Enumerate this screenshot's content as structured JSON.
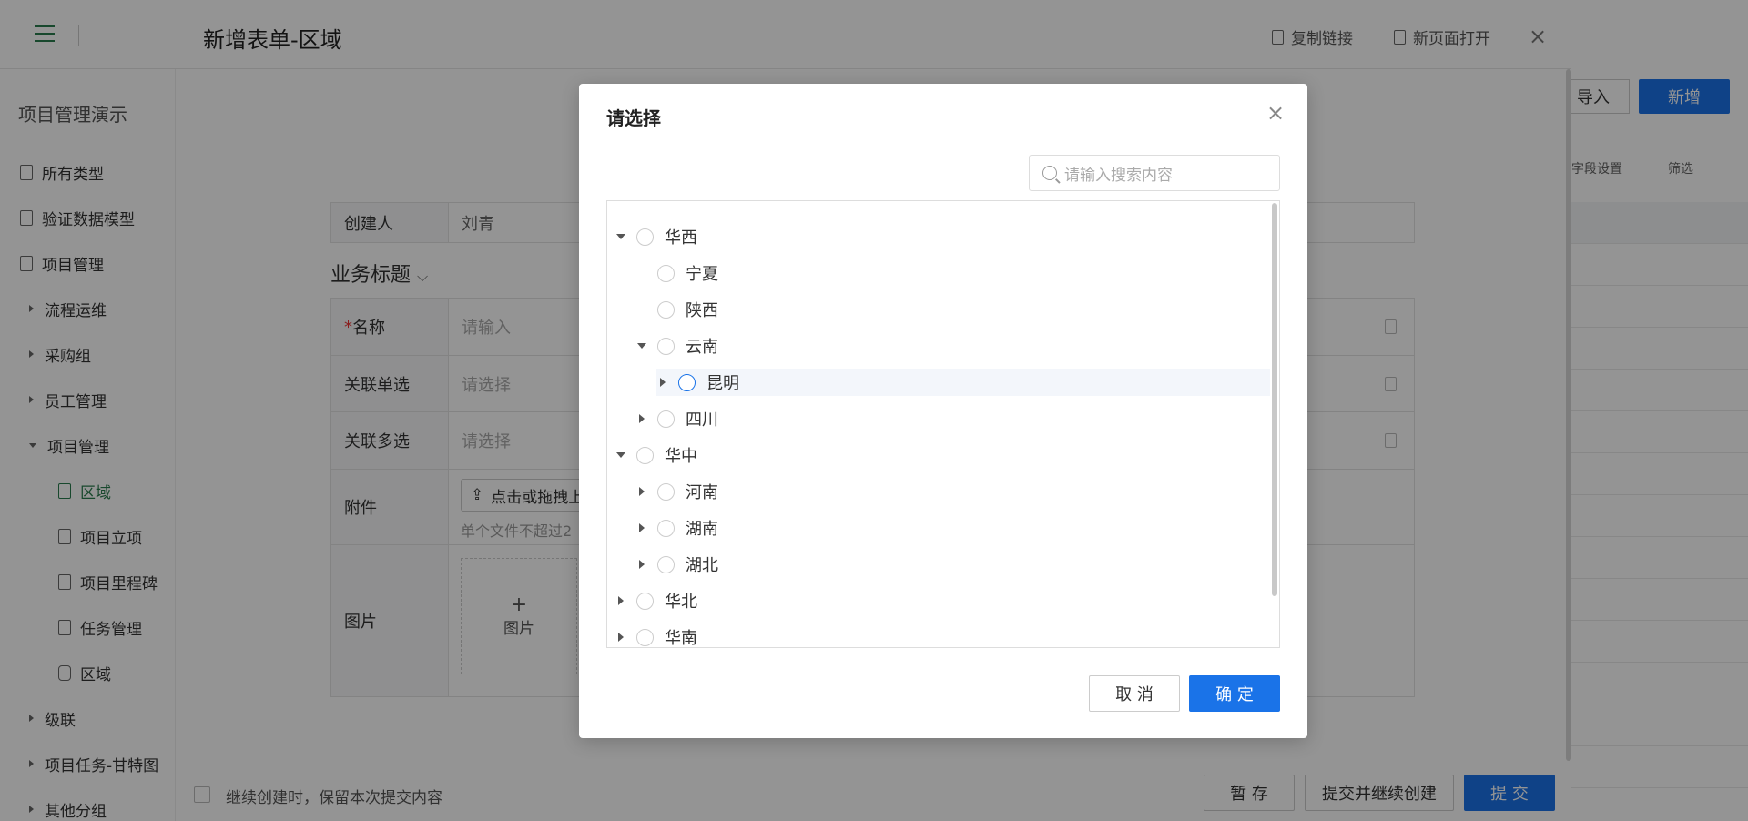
{
  "app": {
    "sidebar_title": "项目管理演示",
    "language": "EN",
    "sidebar_items": [
      {
        "label": "所有类型",
        "kind": "doc"
      },
      {
        "label": "验证数据模型",
        "kind": "doc"
      },
      {
        "label": "项目管理",
        "kind": "doc"
      },
      {
        "label": "流程运维",
        "kind": "group-collapsed"
      },
      {
        "label": "采购组",
        "kind": "group-collapsed"
      },
      {
        "label": "员工管理",
        "kind": "group-collapsed"
      },
      {
        "label": "项目管理",
        "kind": "group-expanded"
      },
      {
        "label": "区域",
        "kind": "doc-child-active"
      },
      {
        "label": "项目立项",
        "kind": "doc-child"
      },
      {
        "label": "项目里程碑",
        "kind": "doc-child"
      },
      {
        "label": "任务管理",
        "kind": "doc-child"
      },
      {
        "label": "区域",
        "kind": "cube-child"
      },
      {
        "label": "级联",
        "kind": "group-collapsed"
      },
      {
        "label": "项目任务-甘特图",
        "kind": "group-collapsed"
      },
      {
        "label": "其他分组",
        "kind": "group-collapsed"
      }
    ],
    "right": {
      "import_label": "导入",
      "new_label": "新增",
      "field_settings": "字段设置",
      "filter": "筛选"
    },
    "accent": "#1a73e8",
    "brand_green": "#2a7d4f"
  },
  "drawer": {
    "title": "新增表单-区域",
    "copy_link": "复制链接",
    "open_new_page": "新页面打开",
    "close": "×",
    "creator_label": "创建人",
    "creator_value": "刘青",
    "section_title": "业务标题",
    "fields": {
      "name_label": "名称",
      "name_placeholder": "请输入",
      "single_label": "关联单选",
      "single_placeholder": "请选择",
      "multi_label": "关联多选",
      "multi_placeholder": "请选择",
      "attach_label": "附件",
      "attach_button": "点击或拖拽上",
      "attach_hint": "单个文件不超过2",
      "image_label": "图片",
      "image_add": "+",
      "image_add_label": "图片"
    },
    "footer": {
      "keep_label": "继续创建时，保留本次提交内容",
      "draft": "暂 存",
      "submit_continue": "提交并继续创建",
      "submit": "提 交"
    }
  },
  "modal": {
    "title": "请选择",
    "close": "×",
    "search_placeholder": "请输入搜索内容",
    "cancel": "取 消",
    "confirm": "确 定",
    "tree": [
      {
        "label": "华西",
        "level": 0,
        "toggle": "down"
      },
      {
        "label": "宁夏",
        "level": 1,
        "toggle": "none"
      },
      {
        "label": "陕西",
        "level": 1,
        "toggle": "none"
      },
      {
        "label": "云南",
        "level": 1,
        "toggle": "down"
      },
      {
        "label": "昆明",
        "level": 2,
        "toggle": "right",
        "highlight": true
      },
      {
        "label": "四川",
        "level": 1,
        "toggle": "right"
      },
      {
        "label": "华中",
        "level": 0,
        "toggle": "down"
      },
      {
        "label": "河南",
        "level": 1,
        "toggle": "right"
      },
      {
        "label": "湖南",
        "level": 1,
        "toggle": "right"
      },
      {
        "label": "湖北",
        "level": 1,
        "toggle": "right"
      },
      {
        "label": "华北",
        "level": 0,
        "toggle": "right"
      },
      {
        "label": "华南",
        "level": 0,
        "toggle": "right"
      }
    ]
  }
}
